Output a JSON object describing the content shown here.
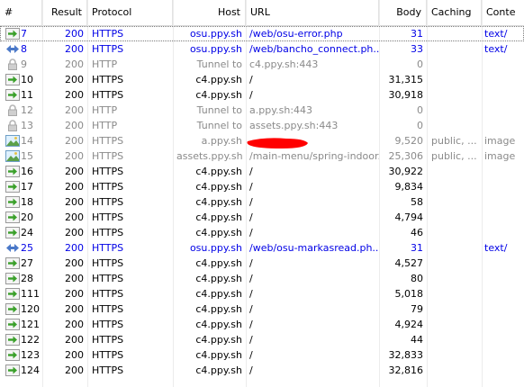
{
  "columns": {
    "num": "#",
    "result": "Result",
    "protocol": "Protocol",
    "host": "Host",
    "url": "URL",
    "body": "Body",
    "caching": "Caching",
    "content": "Conte"
  },
  "colors": {
    "blue_text": "#0000e6",
    "gray_text": "#8a8a8a",
    "arrow_green": "#3aa02a",
    "redaction": "#ff0000"
  },
  "rows": [
    {
      "id": "7",
      "result": "200",
      "protocol": "HTTPS",
      "host": "osu.ppy.sh",
      "url": "/web/osu-error.php",
      "body": "31",
      "caching": "",
      "content": "text/",
      "style": "blue",
      "icon": "green-arrow-icon",
      "selected": true
    },
    {
      "id": "8",
      "result": "200",
      "protocol": "HTTPS",
      "host": "osu.ppy.sh",
      "url": "/web/bancho_connect.ph...",
      "body": "33",
      "caching": "",
      "content": "text/",
      "style": "blue",
      "icon": "bidirectional-arrows-icon",
      "selected": false
    },
    {
      "id": "9",
      "result": "200",
      "protocol": "HTTP",
      "host": "Tunnel to",
      "url": "c4.ppy.sh:443",
      "body": "0",
      "caching": "",
      "content": "",
      "style": "gray",
      "icon": "lock-icon",
      "selected": false
    },
    {
      "id": "10",
      "result": "200",
      "protocol": "HTTPS",
      "host": "c4.ppy.sh",
      "url": "/",
      "body": "31,315",
      "caching": "",
      "content": "",
      "style": "black",
      "icon": "green-arrow-icon",
      "selected": false
    },
    {
      "id": "11",
      "result": "200",
      "protocol": "HTTPS",
      "host": "c4.ppy.sh",
      "url": "/",
      "body": "30,918",
      "caching": "",
      "content": "",
      "style": "black",
      "icon": "green-arrow-icon",
      "selected": false
    },
    {
      "id": "12",
      "result": "200",
      "protocol": "HTTP",
      "host": "Tunnel to",
      "url": "a.ppy.sh:443",
      "body": "0",
      "caching": "",
      "content": "",
      "style": "gray",
      "icon": "lock-icon",
      "selected": false
    },
    {
      "id": "13",
      "result": "200",
      "protocol": "HTTP",
      "host": "Tunnel to",
      "url": "assets.ppy.sh:443",
      "body": "0",
      "caching": "",
      "content": "",
      "style": "gray",
      "icon": "lock-icon",
      "selected": false
    },
    {
      "id": "14",
      "result": "200",
      "protocol": "HTTPS",
      "host": "a.ppy.sh",
      "url": "",
      "body": "9,520",
      "caching": "public, ...",
      "content": "image",
      "style": "gray",
      "icon": "image-icon",
      "selected": false
    },
    {
      "id": "15",
      "result": "200",
      "protocol": "HTTPS",
      "host": "assets.ppy.sh",
      "url": "/main-menu/spring-indoor...",
      "body": "25,306",
      "caching": "public, ...",
      "content": "image",
      "style": "gray",
      "icon": "image-icon",
      "selected": false
    },
    {
      "id": "16",
      "result": "200",
      "protocol": "HTTPS",
      "host": "c4.ppy.sh",
      "url": "/",
      "body": "30,922",
      "caching": "",
      "content": "",
      "style": "black",
      "icon": "green-arrow-icon",
      "selected": false
    },
    {
      "id": "17",
      "result": "200",
      "protocol": "HTTPS",
      "host": "c4.ppy.sh",
      "url": "/",
      "body": "9,834",
      "caching": "",
      "content": "",
      "style": "black",
      "icon": "green-arrow-icon",
      "selected": false
    },
    {
      "id": "18",
      "result": "200",
      "protocol": "HTTPS",
      "host": "c4.ppy.sh",
      "url": "/",
      "body": "58",
      "caching": "",
      "content": "",
      "style": "black",
      "icon": "green-arrow-icon",
      "selected": false
    },
    {
      "id": "20",
      "result": "200",
      "protocol": "HTTPS",
      "host": "c4.ppy.sh",
      "url": "/",
      "body": "4,794",
      "caching": "",
      "content": "",
      "style": "black",
      "icon": "green-arrow-icon",
      "selected": false
    },
    {
      "id": "24",
      "result": "200",
      "protocol": "HTTPS",
      "host": "c4.ppy.sh",
      "url": "/",
      "body": "46",
      "caching": "",
      "content": "",
      "style": "black",
      "icon": "green-arrow-icon",
      "selected": false
    },
    {
      "id": "25",
      "result": "200",
      "protocol": "HTTPS",
      "host": "osu.ppy.sh",
      "url": "/web/osu-markasread.ph...",
      "body": "31",
      "caching": "",
      "content": "text/",
      "style": "blue",
      "icon": "bidirectional-arrows-icon",
      "selected": false
    },
    {
      "id": "27",
      "result": "200",
      "protocol": "HTTPS",
      "host": "c4.ppy.sh",
      "url": "/",
      "body": "4,527",
      "caching": "",
      "content": "",
      "style": "black",
      "icon": "green-arrow-icon",
      "selected": false
    },
    {
      "id": "28",
      "result": "200",
      "protocol": "HTTPS",
      "host": "c4.ppy.sh",
      "url": "/",
      "body": "80",
      "caching": "",
      "content": "",
      "style": "black",
      "icon": "green-arrow-icon",
      "selected": false
    },
    {
      "id": "111",
      "result": "200",
      "protocol": "HTTPS",
      "host": "c4.ppy.sh",
      "url": "/",
      "body": "5,018",
      "caching": "",
      "content": "",
      "style": "black",
      "icon": "green-arrow-icon",
      "selected": false
    },
    {
      "id": "120",
      "result": "200",
      "protocol": "HTTPS",
      "host": "c4.ppy.sh",
      "url": "/",
      "body": "79",
      "caching": "",
      "content": "",
      "style": "black",
      "icon": "green-arrow-icon",
      "selected": false
    },
    {
      "id": "121",
      "result": "200",
      "protocol": "HTTPS",
      "host": "c4.ppy.sh",
      "url": "/",
      "body": "4,924",
      "caching": "",
      "content": "",
      "style": "black",
      "icon": "green-arrow-icon",
      "selected": false
    },
    {
      "id": "122",
      "result": "200",
      "protocol": "HTTPS",
      "host": "c4.ppy.sh",
      "url": "/",
      "body": "44",
      "caching": "",
      "content": "",
      "style": "black",
      "icon": "green-arrow-icon",
      "selected": false
    },
    {
      "id": "123",
      "result": "200",
      "protocol": "HTTPS",
      "host": "c4.ppy.sh",
      "url": "/",
      "body": "32,833",
      "caching": "",
      "content": "",
      "style": "black",
      "icon": "green-arrow-icon",
      "selected": false
    },
    {
      "id": "124",
      "result": "200",
      "protocol": "HTTPS",
      "host": "c4.ppy.sh",
      "url": "/",
      "body": "32,816",
      "caching": "",
      "content": "",
      "style": "black",
      "icon": "green-arrow-icon",
      "selected": false
    }
  ]
}
